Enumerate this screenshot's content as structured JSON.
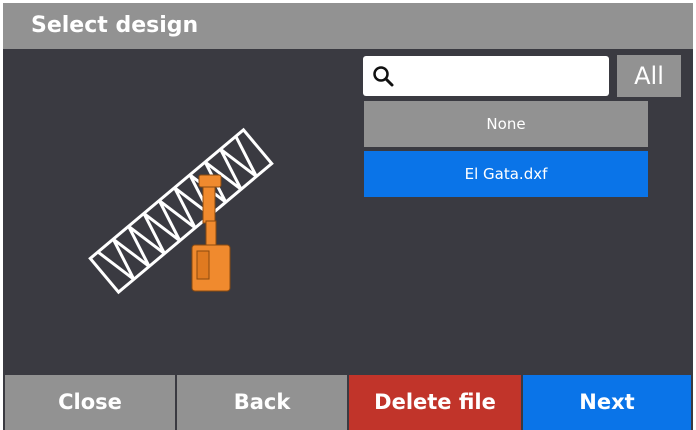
{
  "window": {
    "title": "Select design"
  },
  "search": {
    "value": "",
    "placeholder": "",
    "icon": "search-icon"
  },
  "filter": {
    "all_label": "All"
  },
  "design_list": {
    "items": [
      {
        "label": "None",
        "selected": false
      },
      {
        "label": "El Gata.dxf",
        "selected": true
      }
    ]
  },
  "footer": {
    "close_label": "Close",
    "back_label": "Back",
    "delete_label": "Delete file",
    "next_label": "Next"
  },
  "colors": {
    "background": "#3a3a41",
    "panel_gray": "#929292",
    "accent_blue": "#0a74e8",
    "danger_red": "#c1342a",
    "machine_orange": "#f08a2e"
  }
}
